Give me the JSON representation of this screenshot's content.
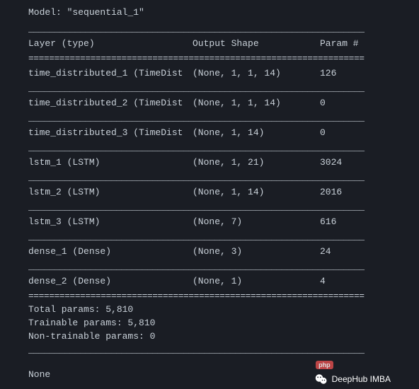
{
  "model_title": "Model: \"sequential_1\"",
  "headers": {
    "layer": "Layer (type)",
    "output": "Output Shape",
    "param": "Param #"
  },
  "rows": [
    {
      "layer": "time_distributed_1 (TimeDist",
      "output": "(None, 1, 1, 14)",
      "param": "126"
    },
    {
      "layer": "time_distributed_2 (TimeDist",
      "output": "(None, 1, 1, 14)",
      "param": "0"
    },
    {
      "layer": "time_distributed_3 (TimeDist",
      "output": "(None, 1, 14)",
      "param": "0"
    },
    {
      "layer": "lstm_1 (LSTM)",
      "output": "(None, 1, 21)",
      "param": "3024"
    },
    {
      "layer": "lstm_2 (LSTM)",
      "output": "(None, 1, 14)",
      "param": "2016"
    },
    {
      "layer": "lstm_3 (LSTM)",
      "output": "(None, 7)",
      "param": "616"
    },
    {
      "layer": "dense_1 (Dense)",
      "output": "(None, 3)",
      "param": "24"
    },
    {
      "layer": "dense_2 (Dense)",
      "output": "(None, 1)",
      "param": "4"
    }
  ],
  "summary": {
    "total": "Total params: 5,810",
    "trainable": "Trainable params: 5,810",
    "nontrainable": "Non-trainable params: 0"
  },
  "none_text": "None",
  "footer_text": "DeepHub IMBA",
  "badge_text": "php",
  "hr_text": "_________________________________________________________________",
  "eq_text": "================================================================="
}
